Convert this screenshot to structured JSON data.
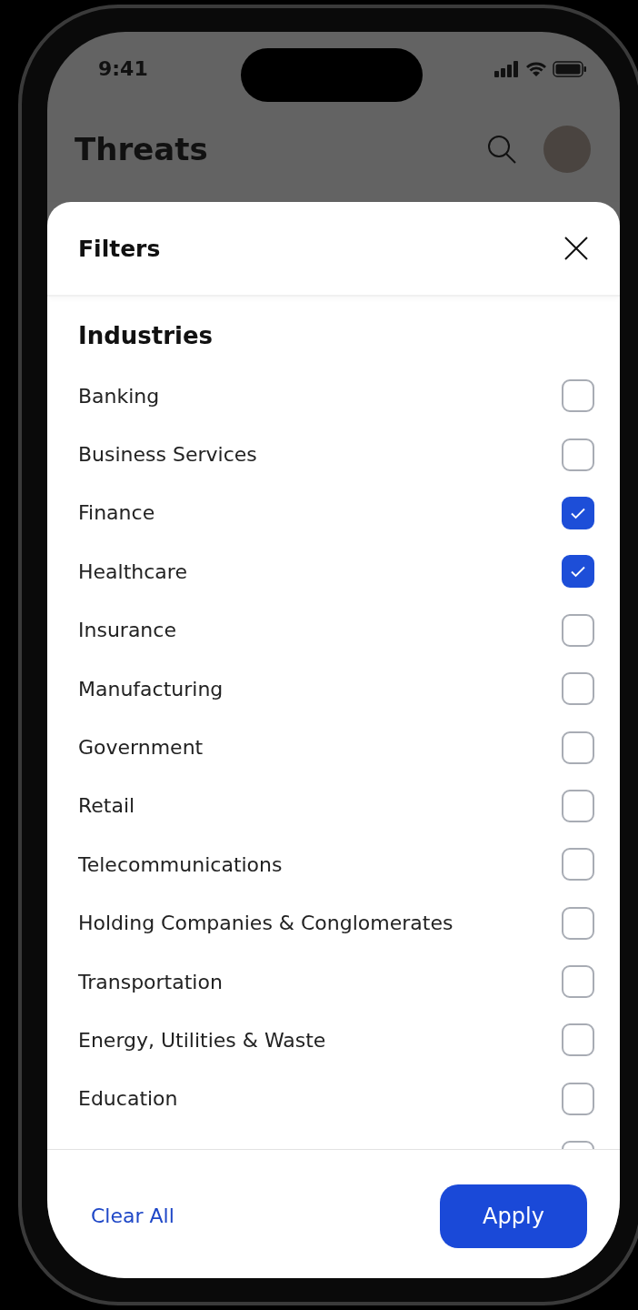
{
  "status_bar": {
    "time": "9:41"
  },
  "header": {
    "title": "Threats"
  },
  "filters_sheet": {
    "title": "Filters",
    "section": "Industries",
    "items": [
      {
        "label": "Banking",
        "checked": false
      },
      {
        "label": "Business Services",
        "checked": false
      },
      {
        "label": "Finance",
        "checked": true
      },
      {
        "label": "Healthcare",
        "checked": true
      },
      {
        "label": "Insurance",
        "checked": false
      },
      {
        "label": "Manufacturing",
        "checked": false
      },
      {
        "label": "Government",
        "checked": false
      },
      {
        "label": "Retail",
        "checked": false
      },
      {
        "label": "Telecommunications",
        "checked": false
      },
      {
        "label": "Holding Companies & Conglomerates",
        "checked": false
      },
      {
        "label": "Transportation",
        "checked": false
      },
      {
        "label": "Energy, Utilities & Waste",
        "checked": false
      },
      {
        "label": "Education",
        "checked": false
      },
      {
        "checked": false
      }
    ],
    "footer": {
      "clear_label": "Clear All",
      "apply_label": "Apply"
    }
  }
}
